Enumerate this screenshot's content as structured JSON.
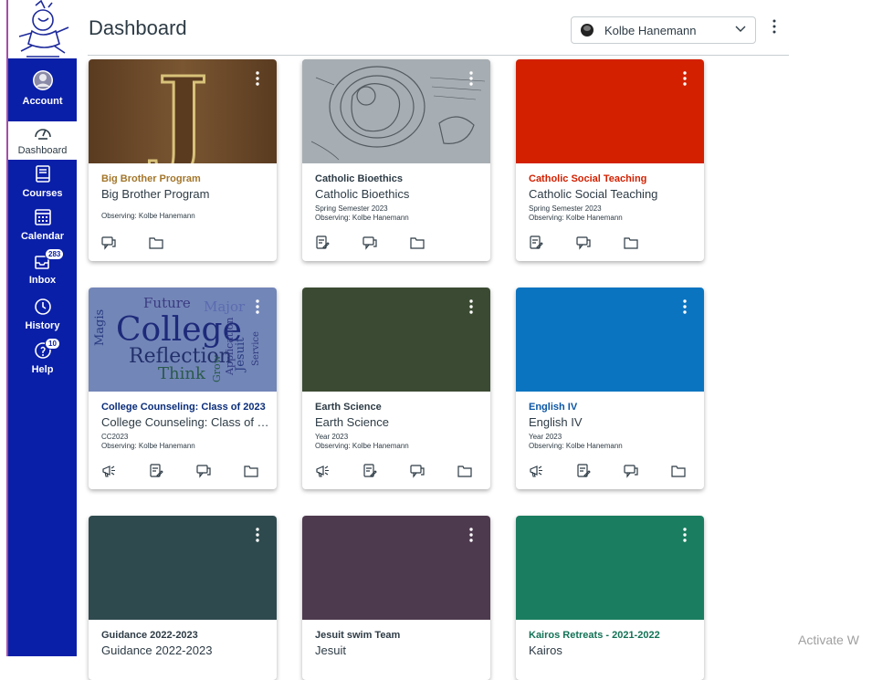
{
  "nav": {
    "items": [
      {
        "label": "Account",
        "icon": "account-icon"
      },
      {
        "label": "Dashboard",
        "icon": "dashboard-icon"
      },
      {
        "label": "Courses",
        "icon": "courses-icon"
      },
      {
        "label": "Calendar",
        "icon": "calendar-icon"
      },
      {
        "label": "Inbox",
        "icon": "inbox-icon",
        "badge": "283"
      },
      {
        "label": "History",
        "icon": "history-icon"
      },
      {
        "label": "Help",
        "icon": "help-icon",
        "badge": "10"
      }
    ],
    "active": "Dashboard",
    "rail_color": "#0a1fa8"
  },
  "header": {
    "title": "Dashboard",
    "observer": "Kolbe Hanemann"
  },
  "cards": [
    {
      "link": "Big Brother Program",
      "name": "Big Brother Program",
      "term": "",
      "observing": "Observing: Kolbe Hanemann",
      "color": "#a3762a",
      "hero": "#6b4a2a"
    },
    {
      "link": "Catholic Bioethics",
      "name": "Catholic Bioethics",
      "term": "Spring Semester 2023",
      "observing": "Observing: Kolbe Hanemann",
      "color": "#2d3b45",
      "hero": "#9aa2a8"
    },
    {
      "link": "Catholic Social Teaching",
      "name": "Catholic Social Teaching",
      "term": "Spring Semester 2023",
      "observing": "Observing: Kolbe Hanemann",
      "color": "#d32000",
      "hero": "#d32000"
    },
    {
      "link": "College Counseling: Class of 2023",
      "name": "College Counseling: Class of 2...",
      "term": "CC2023",
      "observing": "Observing: Kolbe Hanemann",
      "color": "#0a2d7a",
      "hero": "#7386b8"
    },
    {
      "link": "Earth Science",
      "name": "Earth Science",
      "term": "Year 2023",
      "observing": "Observing: Kolbe Hanemann",
      "color": "#2d3b45",
      "hero": "#3b4b33"
    },
    {
      "link": "English IV",
      "name": "English IV",
      "term": "Year 2023",
      "observing": "Observing: Kolbe Hanemann",
      "color": "#0b56a5",
      "hero": "#0b74c0"
    },
    {
      "link": "Guidance 2022-2023",
      "name": "Guidance 2022-2023",
      "term": "",
      "observing": "",
      "color": "#2d3b45",
      "hero": "#2f4a4e"
    },
    {
      "link": "Jesuit swim Team",
      "name": "Jesuit",
      "term": "",
      "observing": "",
      "color": "#2d3b45",
      "hero": "#4e3a4e"
    },
    {
      "link": "Kairos Retreats - 2021-2022",
      "name": "Kairos",
      "term": "",
      "observing": "",
      "color": "#127255",
      "hero": "#1a7d5f"
    }
  ],
  "hero_text": {
    "big_j": "J",
    "wordcloud": [
      "College",
      "Reflection",
      "Think",
      "Future",
      "Major",
      "Magis",
      "Jesuit",
      "Application",
      "Grow",
      "Service"
    ]
  },
  "watermark": "Activate W"
}
